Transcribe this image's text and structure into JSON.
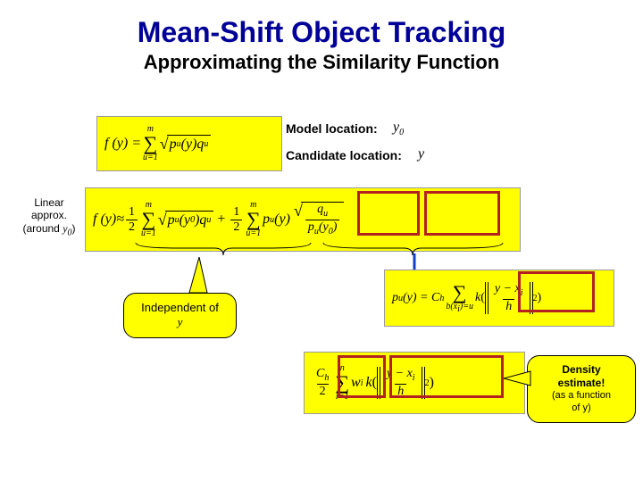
{
  "title": "Mean-Shift Object Tracking",
  "subtitle": "Approximating the Similarity Function",
  "labels": {
    "model_loc": "Model location:",
    "candidate_loc": "Candidate location:",
    "model_sym": "y",
    "model_sub": "0",
    "cand_sym": "y",
    "linear1": "Linear",
    "linear2": "approx.",
    "linear3_a": "(around ",
    "linear3_y": "y",
    "linear3_sub": "0",
    "linear3_b": ")"
  },
  "callouts": {
    "indep1": "Independent of",
    "indep2": "y",
    "density1": "Density",
    "density2": "estimate!",
    "density3": "(as a function",
    "density4": "of y)"
  },
  "equations": {
    "f_def": {
      "lhs": "f (y) =",
      "sum_top": "m",
      "sum_bot": "u=1",
      "rad_body": "p",
      "rad_sub": "u",
      "rad_arg": "(y)",
      "q": "q",
      "q_sub": "u"
    },
    "f_lin": {
      "lhs": "f (y)≈",
      "half": "1",
      "half_d": "2",
      "sum_top": "m",
      "sum_bot": "u=1",
      "rad_p": "p",
      "rad_u": "u",
      "rad_arg": "(y",
      "rad_sub0": "0",
      "rad_arg2": ")",
      "q": "q",
      "q_sub": "u",
      "plus": "+",
      "half2n": "1",
      "half2d": "2",
      "sum2_top": "m",
      "sum2_bot": "u=1",
      "pu": "p",
      "pu_u": "u",
      "pu_arg": "(y)",
      "frac_qn": "q",
      "frac_qn_u": "u",
      "frac_dp": "p",
      "frac_dp_u": "u",
      "frac_dp_arg": "(y",
      "frac_dp_0": "0",
      "frac_dp_arg2": ")"
    },
    "pu_def": {
      "lhs_p": "p",
      "lhs_u": "u",
      "lhs_arg": "(y) = C",
      "lhs_h": "h",
      "sum_top": "",
      "sum_bot": "b(x",
      "sum_bot_i": "i",
      "sum_bot2": ")=u",
      "k": "k",
      "frac_n_a": "y − x",
      "frac_n_i": "i",
      "frac_d": "h",
      "sq": "2"
    },
    "density": {
      "coef_n": "C",
      "coef_h": "h",
      "coef_d": "2",
      "sum_top": "n",
      "sum_bot": "i=1",
      "w": "w",
      "w_i": "i",
      "k": "k",
      "frac_n_a": "y − x",
      "frac_n_i": "i",
      "frac_d": "h",
      "sq": "2"
    }
  }
}
